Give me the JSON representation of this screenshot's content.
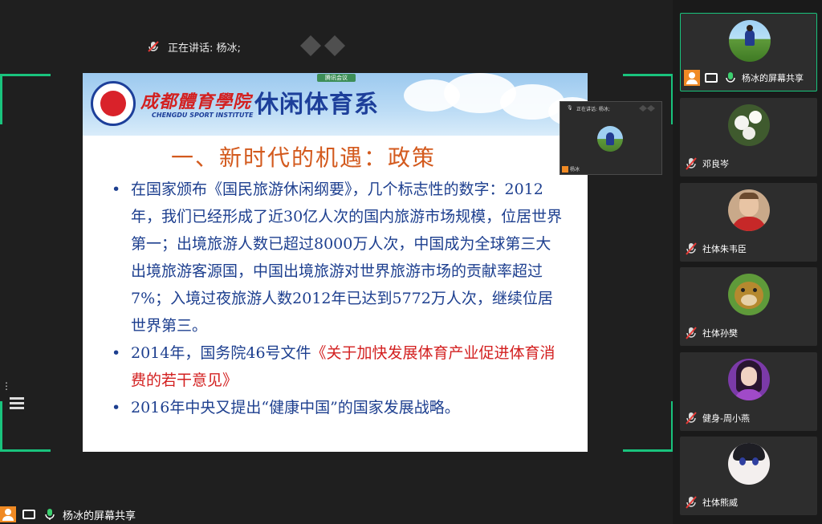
{
  "main": {
    "speaking_label": "正在讲话: 杨冰;",
    "tencent_tag": "腾讯会议",
    "share_label": "杨冰的屏幕共享"
  },
  "slide": {
    "school_name": "成都體育學院",
    "school_en": "CHENGDU SPORT INSTITUTE",
    "dept_name": "休闲体育系",
    "title": "一、新时代的机遇：政策",
    "bullets": [
      {
        "text": "在国家颁布《国民旅游休闲纲要》，几个标志性的数字：2012年，我们已经形成了近30亿人次的国内旅游市场规模，位居世界第一；出境旅游人数已超过8000万人次，中国成为全球第三大出境旅游客源国，中国出境旅游对世界旅游市场的贡献率超过7%；入境过夜旅游人数2012年已达到5772万人次，继续位居世界第三。"
      },
      {
        "prefix": "2014年，国务院46号文件",
        "red": "《关于加快发展体育产业促进体育消费的若干意见》"
      },
      {
        "text": "2016年中央又提出“健康中国”的国家发展战略。"
      }
    ]
  },
  "mini_view": {
    "speaking": "正在讲话: 杨冰;",
    "name": "杨冰"
  },
  "participants": [
    {
      "name": "杨冰的屏幕共享",
      "avatar": "grass-field",
      "active": true
    },
    {
      "name": "邓良岑",
      "avatar": "white-flower"
    },
    {
      "name": "社体朱韦臣",
      "avatar": "football-player"
    },
    {
      "name": "社体孙樊",
      "avatar": "cartoon-bear"
    },
    {
      "name": "健身-周小燕",
      "avatar": "anime-girl"
    },
    {
      "name": "社体熊威",
      "avatar": "anime-boy"
    }
  ],
  "colors": {
    "accent_green": "#19c37d",
    "host_orange": "#f08a24",
    "slide_blue": "#1d3f8f",
    "slide_red": "#d32020",
    "title_orange": "#d35a1e"
  }
}
